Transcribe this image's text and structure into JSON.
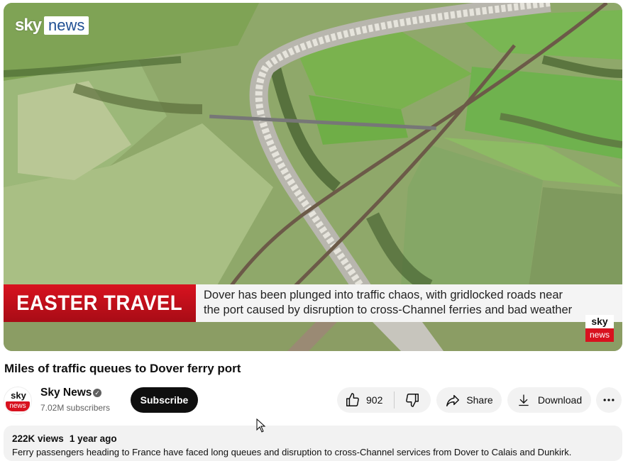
{
  "video": {
    "watermark_sky": "sky",
    "watermark_news": "news",
    "lower_third": {
      "tag": "EASTER TRAVEL",
      "line1": "Dover has been plunged into traffic chaos, with gridlocked roads near",
      "line2": "the port caused by disruption to cross-Channel ferries and bad weather"
    },
    "bug_sky": "sky",
    "bug_news": "news"
  },
  "title": "Miles of traffic queues to Dover ferry port",
  "channel": {
    "avatar_sky": "sky",
    "avatar_news": "news",
    "name": "Sky News",
    "verified_icon": "check-circle-icon",
    "subscribers": "7.02M subscribers"
  },
  "actions": {
    "subscribe": "Subscribe",
    "like_count": "902",
    "share": "Share",
    "download": "Download"
  },
  "description": {
    "views": "222K views",
    "age": "1 year ago",
    "text": "Ferry passengers heading to France have faced long queues and disruption to cross-Channel services from Dover to Calais and Dunkirk."
  },
  "colors": {
    "brand_red": "#d8121f",
    "subscribe_bg": "#0f0f0f",
    "pill_bg": "#f2f2f2"
  }
}
